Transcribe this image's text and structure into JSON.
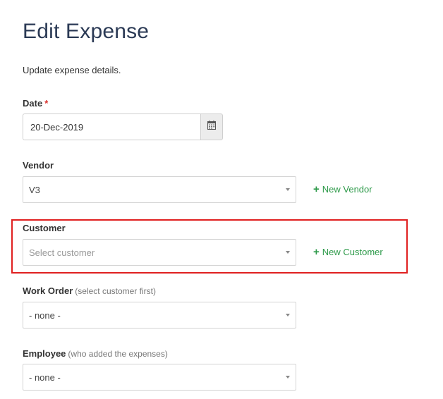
{
  "page": {
    "title": "Edit Expense",
    "subtitle": "Update expense details."
  },
  "date": {
    "label": "Date",
    "required_mark": "*",
    "value": "20-Dec-2019",
    "icon": "calendar-icon"
  },
  "vendor": {
    "label": "Vendor",
    "selected": "V3",
    "add_label": "New Vendor",
    "add_icon": "plus-icon"
  },
  "customer": {
    "label": "Customer",
    "placeholder": "Select customer",
    "add_label": "New Customer",
    "add_icon": "plus-icon"
  },
  "work_order": {
    "label": "Work Order",
    "hint": "(select customer first)",
    "selected": "- none -"
  },
  "employee": {
    "label": "Employee",
    "hint": "(who added the expenses)",
    "selected": "- none -"
  },
  "colors": {
    "title": "#2b3a55",
    "required": "#d9302c",
    "link_green": "#2e9a4a",
    "highlight": "#e02020"
  }
}
